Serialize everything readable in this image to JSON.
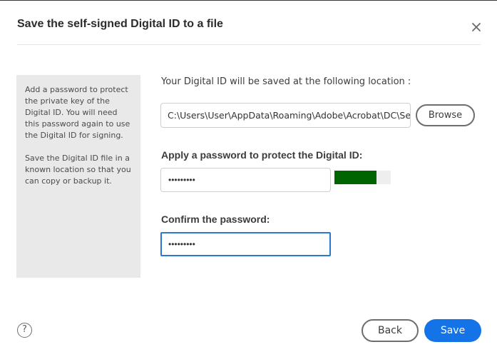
{
  "dialog": {
    "title": "Save the self-signed Digital ID to a file",
    "close_icon": "close-icon"
  },
  "info_panel": {
    "paragraph1": "Add a password to protect the private key of the Digital ID. You will need this password again to use the Digital ID for signing.",
    "paragraph2": "Save the Digital ID file in a known location so that you can copy or backup it."
  },
  "location": {
    "label": "Your Digital ID will be saved at the following location :",
    "path_value": "C:\\Users\\User\\AppData\\Roaming\\Adobe\\Acrobat\\DC\\Security\\User.pfx",
    "browse_label": "Browse"
  },
  "password": {
    "label": "Apply a password to protect the Digital ID:",
    "value": "•••••••••",
    "strength_fraction": 0.75,
    "strength_color": "#006400"
  },
  "confirm": {
    "label": "Confirm the password:",
    "value": "•••••••••"
  },
  "footer": {
    "help_icon": "help-icon",
    "help_glyph": "?",
    "back_label": "Back",
    "save_label": "Save"
  },
  "colors": {
    "accent": "#1473e6",
    "focus_border": "#2b78d0",
    "panel_bg": "#e9e9e9"
  }
}
